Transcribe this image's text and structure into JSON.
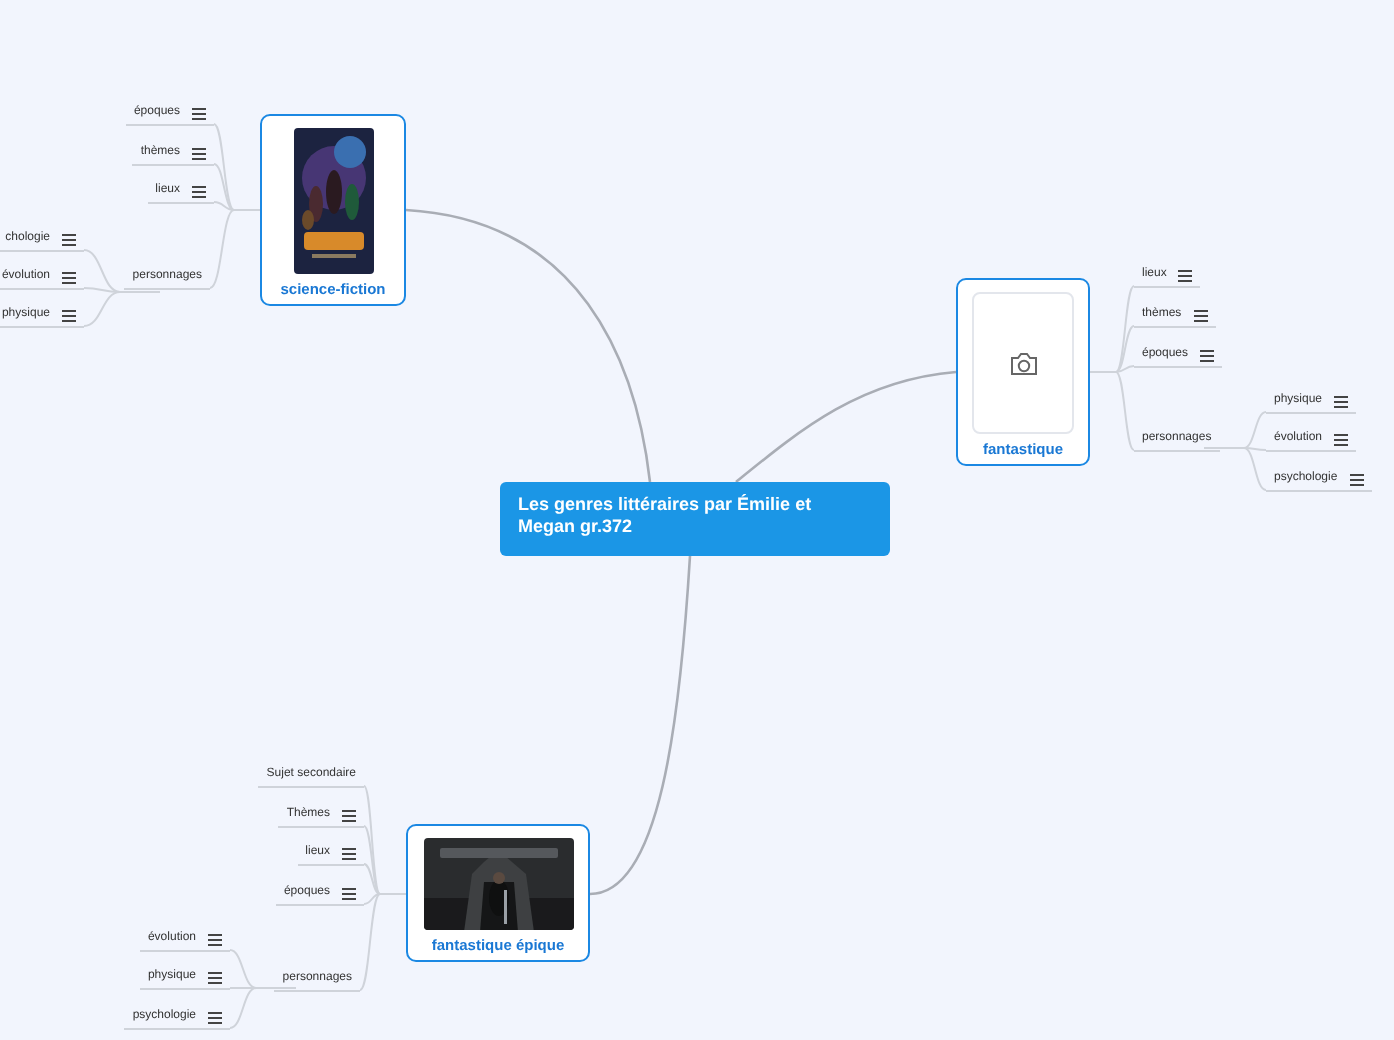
{
  "central_topic": {
    "title": "Les genres littéraires par Émilie et Megan gr.372"
  },
  "branches": [
    {
      "label": "science-fiction",
      "image": {
        "kind": "picture"
      },
      "children": [
        {
          "label": "époques",
          "has_notes": true
        },
        {
          "label": "thèmes",
          "has_notes": true
        },
        {
          "label": "lieux",
          "has_notes": true
        },
        {
          "label": "personnages",
          "has_notes": false,
          "children": [
            {
              "label": "chologie",
              "has_notes": true
            },
            {
              "label": "évolution",
              "has_notes": true
            },
            {
              "label": "physique",
              "has_notes": true
            }
          ]
        }
      ]
    },
    {
      "label": "fantastique",
      "image": {
        "kind": "placeholder"
      },
      "children": [
        {
          "label": "lieux",
          "has_notes": true
        },
        {
          "label": "thèmes",
          "has_notes": true
        },
        {
          "label": "époques",
          "has_notes": true
        },
        {
          "label": "personnages",
          "has_notes": false,
          "children": [
            {
              "label": "physique",
              "has_notes": true
            },
            {
              "label": "évolution",
              "has_notes": true
            },
            {
              "label": "psychologie",
              "has_notes": true
            }
          ]
        }
      ]
    },
    {
      "label": "fantastique épique",
      "image": {
        "kind": "picture"
      },
      "children": [
        {
          "label": "Sujet secondaire",
          "has_notes": false
        },
        {
          "label": "Thèmes",
          "has_notes": true
        },
        {
          "label": "lieux",
          "has_notes": true
        },
        {
          "label": "époques",
          "has_notes": true
        },
        {
          "label": "personnages",
          "has_notes": false,
          "children": [
            {
              "label": "évolution",
              "has_notes": true
            },
            {
              "label": "physique",
              "has_notes": true
            },
            {
              "label": "psychologie",
              "has_notes": true
            }
          ]
        }
      ]
    }
  ]
}
